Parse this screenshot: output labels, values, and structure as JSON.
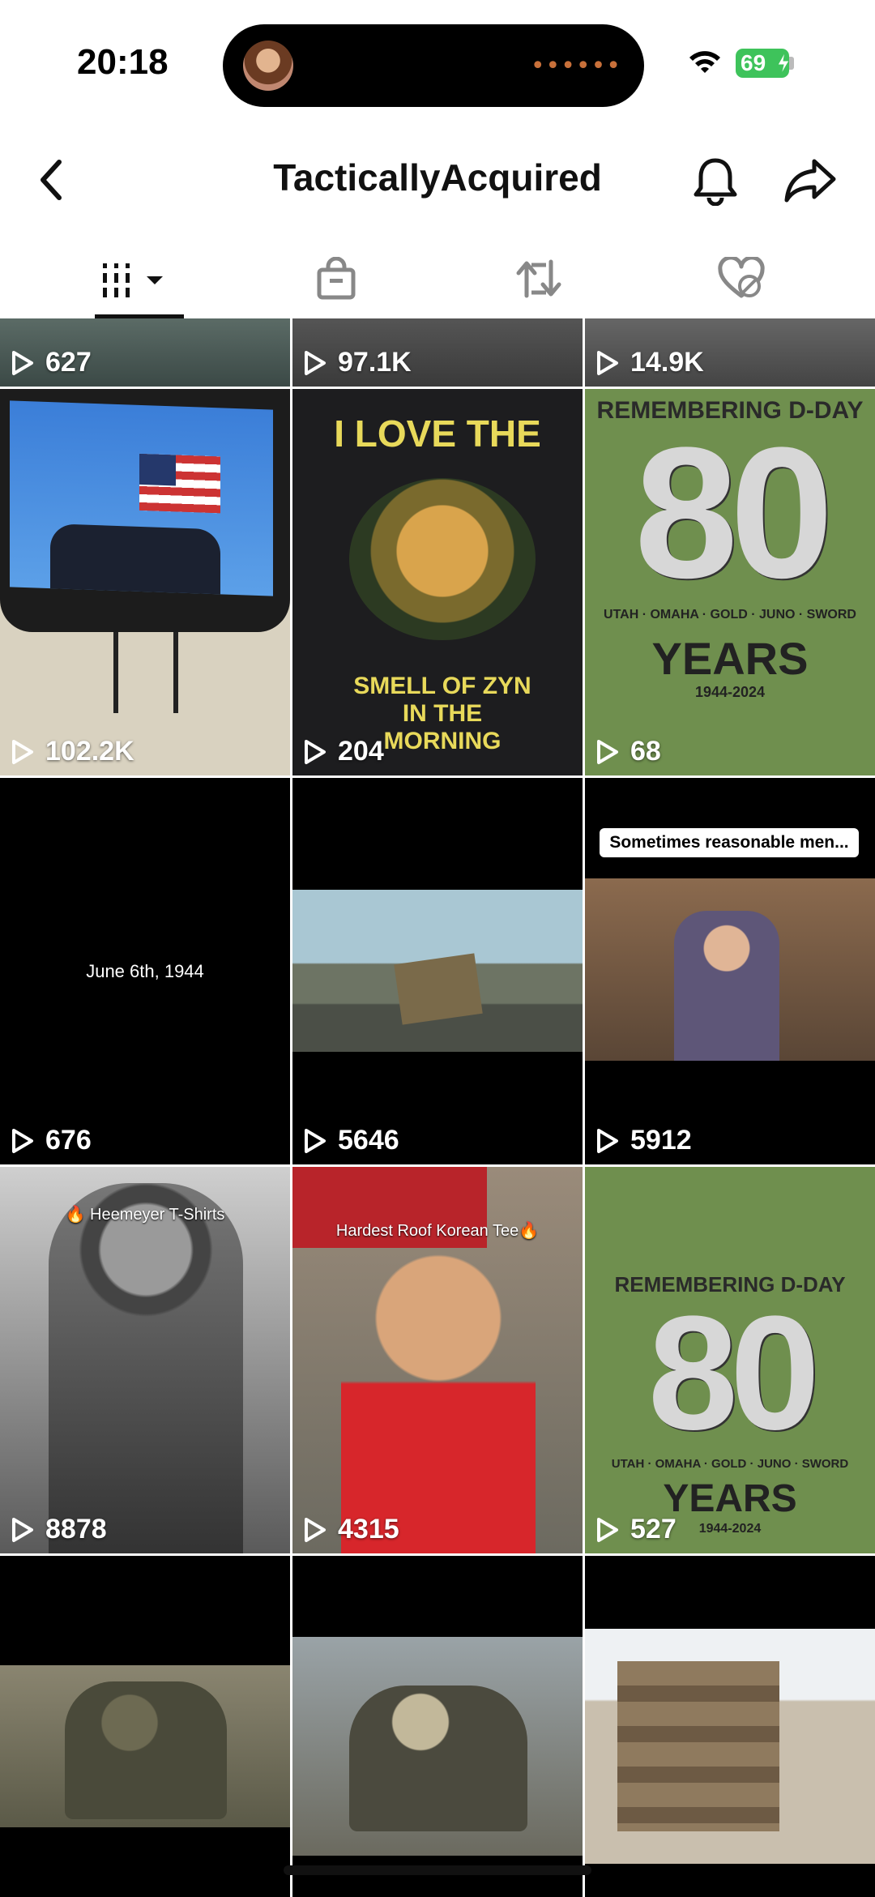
{
  "status_bar": {
    "time": "20:18",
    "battery": "69"
  },
  "header": {
    "title": "TacticallyAcquired"
  },
  "tabs": [
    "videos-tab",
    "shop-tab",
    "reposts-tab",
    "liked-tab"
  ],
  "grid": {
    "rows": [
      {
        "views": [
          "627",
          "97.1K",
          "14.9K"
        ]
      },
      {
        "views": [
          "102.2K",
          "204",
          "68"
        ]
      },
      {
        "views": [
          "676",
          "5646",
          "5912"
        ]
      },
      {
        "views": [
          "8878",
          "4315",
          "527"
        ]
      }
    ],
    "captions": {
      "r1c2_top": "I LOVE THE",
      "r1c2_bottom": "SMELL OF ZYN IN THE MORNING",
      "r1c3_top": "REMEMBERING D-DAY",
      "r1c3_num": "80",
      "r1c3_beaches": "UTAH · OMAHA · GOLD · JUNO · SWORD",
      "r1c3_years": "YEARS",
      "r1c3_range": "1944-2024",
      "r2c1": "June 6th, 1944",
      "r2c3_chip": "Sometimes reasonable men...",
      "r3c1": "🔥 Heemeyer T-Shirts",
      "r3c2": "Hardest Roof Korean Tee🔥",
      "r3c3_top": "REMEMBERING D-DAY",
      "r3c3_num": "80",
      "r3c3_beaches": "UTAH · OMAHA · GOLD · JUNO · SWORD",
      "r3c3_years": "YEARS",
      "r3c3_range": "1944-2024"
    }
  },
  "colors": {
    "battery": "#3ec35b",
    "tshirt_green": "#6f8f4e",
    "accent": "#111111"
  }
}
